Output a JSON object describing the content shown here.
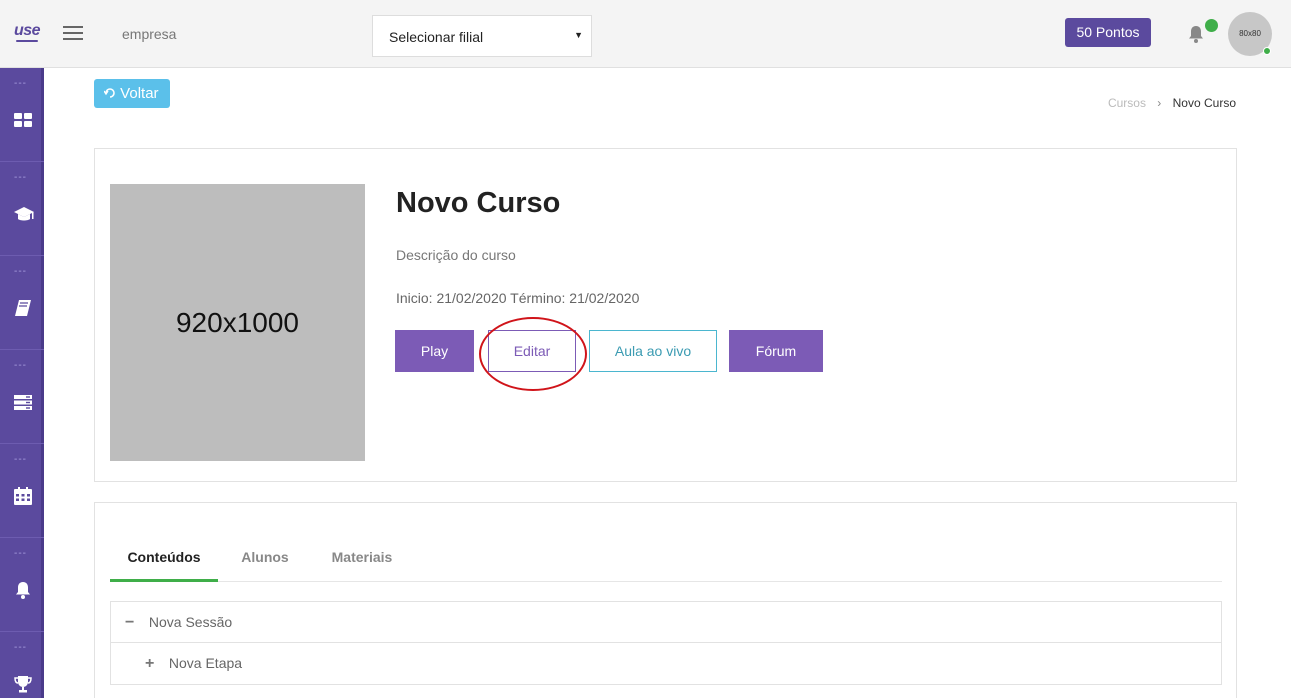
{
  "header": {
    "logo_text": "use",
    "company_label": "empresa",
    "branch_select": {
      "value": "Selecionar filial"
    },
    "points_badge": "50 Pontos",
    "avatar_text": "80x80"
  },
  "sidebar": {
    "items": [
      {
        "dots": "---",
        "icon": "dashboard-icon"
      },
      {
        "dots": "---",
        "icon": "graduation-cap-icon"
      },
      {
        "dots": "---",
        "icon": "book-icon"
      },
      {
        "dots": "---",
        "icon": "list-icon"
      },
      {
        "dots": "---",
        "icon": "calendar-icon"
      },
      {
        "dots": "---",
        "icon": "bell-icon"
      },
      {
        "dots": "---",
        "icon": "trophy-icon"
      }
    ]
  },
  "back_button": {
    "icon": "back-arrow-icon",
    "label": "Voltar"
  },
  "breadcrumb": {
    "parent": "Cursos",
    "separator": "›",
    "current": "Novo Curso"
  },
  "course": {
    "thumbnail_text": "920x1000",
    "title": "Novo Curso",
    "description": "Descrição do curso",
    "dates": "Inicio: 21/02/2020 Término: 21/02/2020",
    "buttons": {
      "play": "Play",
      "edit": "Editar",
      "live": "Aula ao vivo",
      "forum": "Fórum"
    }
  },
  "tabs": [
    {
      "label": "Conteúdos",
      "active": true
    },
    {
      "label": "Alunos",
      "active": false
    },
    {
      "label": "Materiais",
      "active": false
    }
  ],
  "content_tree": {
    "section": {
      "symbol": "−",
      "label": "Nova Sessão"
    },
    "step": {
      "symbol": "+",
      "label": "Nova Etapa"
    }
  },
  "colors": {
    "brand_purple": "#5b4a9e",
    "button_purple": "#7c5bb6",
    "accent_cyan": "#5bc0ea",
    "status_green": "#3fae49",
    "highlight_red": "#d0141a"
  }
}
